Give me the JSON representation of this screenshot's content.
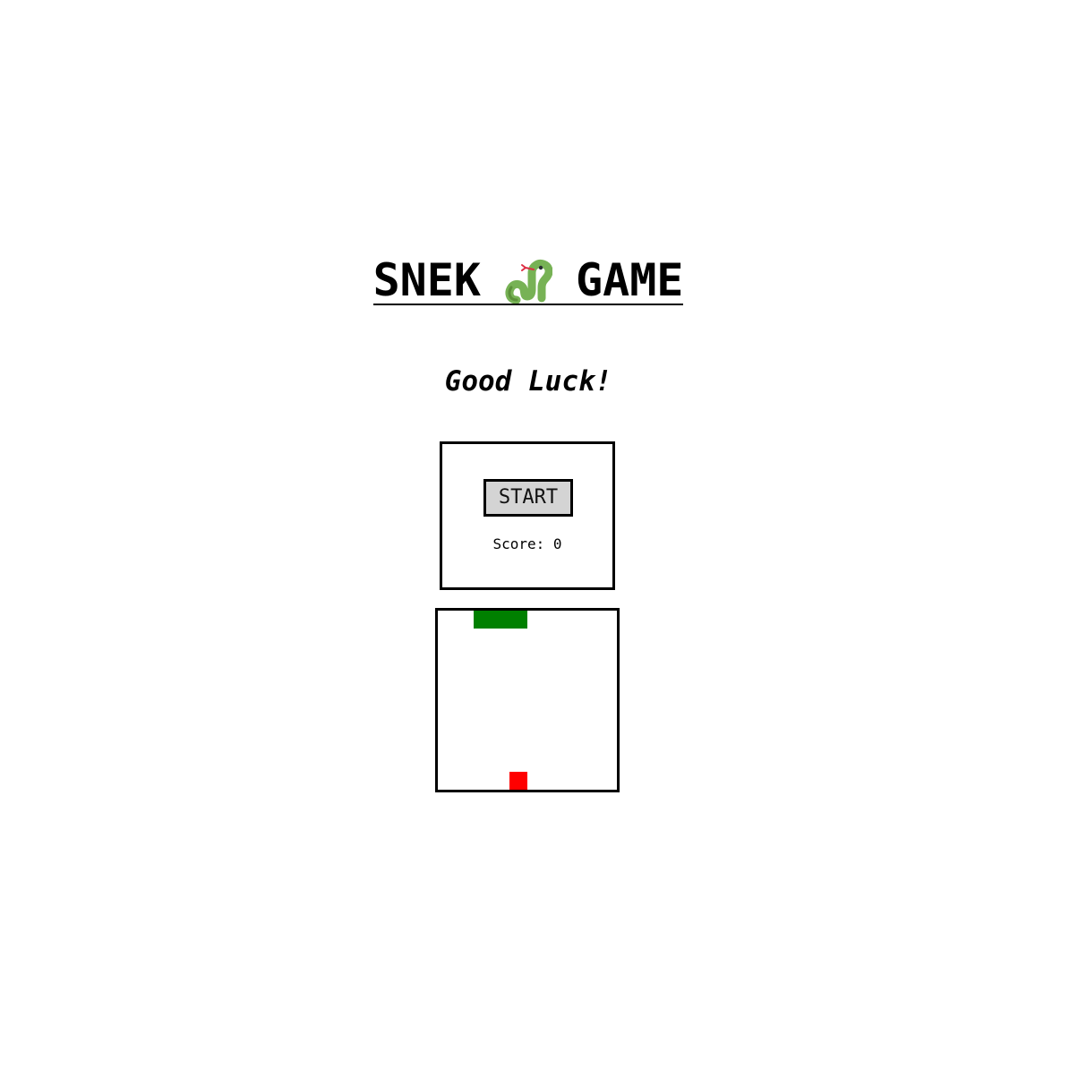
{
  "header": {
    "title_left": "SNEK",
    "title_right": "GAME",
    "title_icon": "snake-icon",
    "subtitle": "Good Luck!"
  },
  "controls": {
    "start_label": "START",
    "score_label": "Score: 0",
    "score": 0
  },
  "game": {
    "grid_columns": 10,
    "grid_rows": 10,
    "snake_color": "#008000",
    "food_color": "#ff0000",
    "snake": [
      {
        "col": 2,
        "row": 0
      },
      {
        "col": 3,
        "row": 0
      },
      {
        "col": 4,
        "row": 0
      }
    ],
    "food": {
      "col": 4,
      "row": 9
    }
  }
}
